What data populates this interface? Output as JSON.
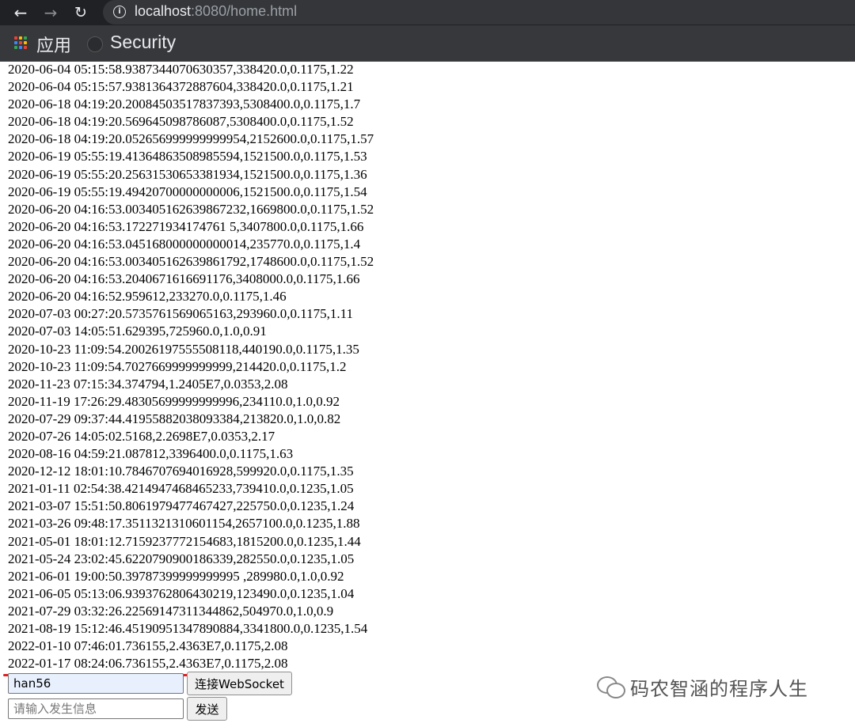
{
  "browser": {
    "url_host": "localhost",
    "url_rest": ":8080/home.html",
    "bookmarks": [
      {
        "label": "应用",
        "icon": "apps-grid-icon"
      },
      {
        "label": "Security",
        "icon": "github-icon"
      }
    ]
  },
  "log_lines": [
    "2020-06-04 05:15:58.9387344070630357,338420.0,0.1175,1.22",
    "2020-06-04 05:15:57.9381364372887604,338420.0,0.1175,1.21",
    "2020-06-18 04:19:20.20084503517837393,5308400.0,0.1175,1.7",
    "2020-06-18 04:19:20.569645098786087,5308400.0,0.1175,1.52",
    "2020-06-18 04:19:20.052656999999999954,2152600.0,0.1175,1.57",
    "2020-06-19 05:55:19.41364863508985594,1521500.0,0.1175,1.53",
    "2020-06-19 05:55:20.25631530653381934,1521500.0,0.1175,1.36",
    "2020-06-19 05:55:19.49420700000000006,1521500.0,0.1175,1.54",
    "2020-06-20 04:16:53.003405162639867232,1669800.0,0.1175,1.52",
    "2020-06-20 04:16:53.172271934174761 5,3407800.0,0.1175,1.66",
    "2020-06-20 04:16:53.045168000000000014,235770.0,0.1175,1.4",
    "2020-06-20 04:16:53.003405162639861792,1748600.0,0.1175,1.52",
    "2020-06-20 04:16:53.2040671616691176,3408000.0,0.1175,1.66",
    "2020-06-20 04:16:52.959612,233270.0,0.1175,1.46",
    "2020-07-03 00:27:20.5735761569065163,293960.0,0.1175,1.11",
    "2020-07-03 14:05:51.629395,725960.0,1.0,0.91",
    "2020-10-23 11:09:54.20026197555508118,440190.0,0.1175,1.35",
    "2020-10-23 11:09:54.7027669999999999,214420.0,0.1175,1.2",
    "2020-11-23 07:15:34.374794,1.2405E7,0.0353,2.08",
    "2020-11-19 17:26:29.48305699999999996,234110.0,1.0,0.92",
    "2020-07-29 09:37:44.41955882038093384,213820.0,1.0,0.82",
    "2020-07-26 14:05:02.5168,2.2698E7,0.0353,2.17",
    "2020-08-16 04:59:21.087812,3396400.0,0.1175,1.63",
    "2020-12-12 18:01:10.7846707694016928,599920.0,0.1175,1.35",
    "2021-01-11 02:54:38.4214947468465233,739410.0,0.1235,1.05",
    "2021-03-07 15:51:50.8061979477467427,225750.0,0.1235,1.24",
    "2021-03-26 09:48:17.3511321310601154,2657100.0,0.1235,1.88",
    "2021-05-01 18:01:12.7159237772154683,1815200.0,0.1235,1.44",
    "2021-05-24 23:02:45.6220790900186339,282550.0,0.1235,1.05",
    "2021-06-01 19:00:50.39787399999999995 ,289980.0,1.0,0.92",
    "2021-06-05 05:13:06.9393762806430219,123490.0,0.1235,1.04",
    "2021-07-29 03:32:26.22569147311344862,504970.0,1.0,0.9",
    "2021-08-19 15:12:46.45190951347890884,3341800.0,0.1235,1.54",
    "2022-01-10 07:46:01.736155,2.4363E7,0.1175,2.08",
    "2022-01-17 08:24:06.736155,2.4363E7,0.1175,2.08"
  ],
  "form": {
    "name_value": "han56",
    "connect_label": "连接WebSocket",
    "message_placeholder": "请输入发生信息",
    "send_label": "发送"
  },
  "watermark": "码农智涵的程序人生",
  "colors": {
    "chrome_dark": "#202124",
    "bookmark_bar": "#37383b",
    "underline_red": "#e02020"
  }
}
